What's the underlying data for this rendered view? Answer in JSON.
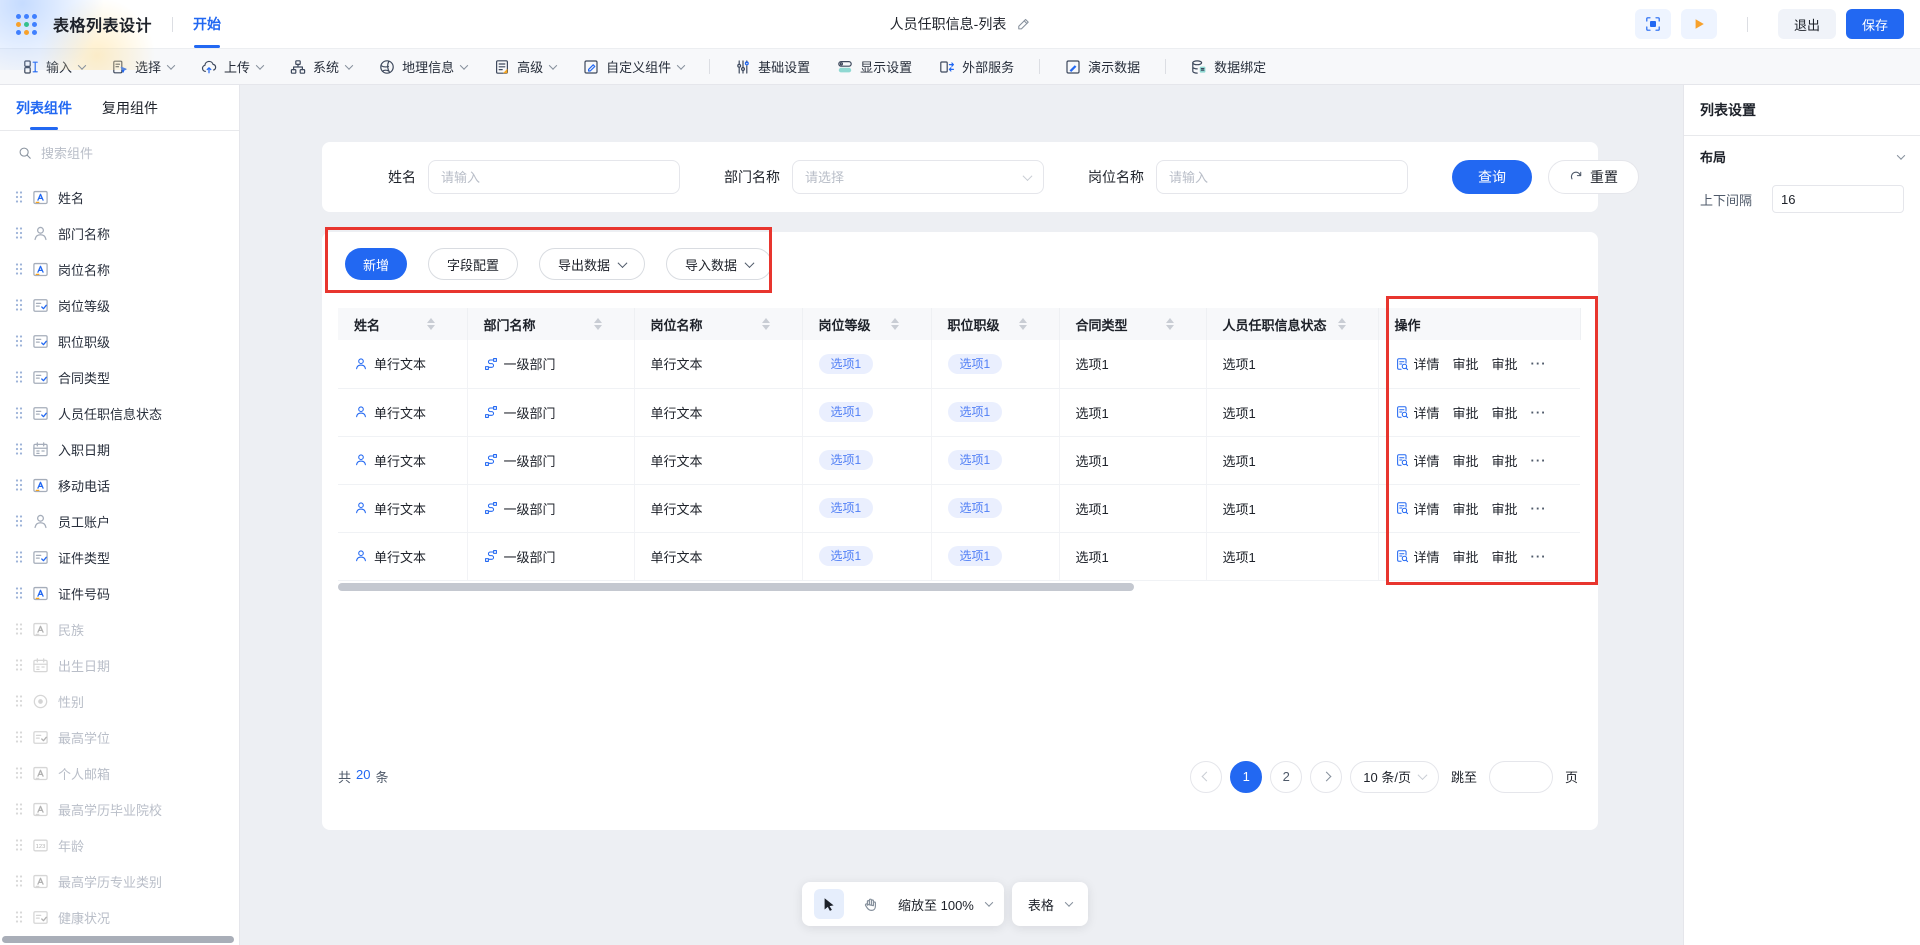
{
  "topbar": {
    "app_title": "表格列表设计",
    "start_tab": "开始",
    "page_title": "人员任职信息-列表",
    "exit": "退出",
    "save": "保存"
  },
  "ribbon": {
    "items": [
      {
        "label": "输入",
        "icon": "input",
        "dropdown": true
      },
      {
        "label": "选择",
        "icon": "selectTool",
        "dropdown": true
      },
      {
        "label": "上传",
        "icon": "upload",
        "dropdown": true
      },
      {
        "label": "系统",
        "icon": "system",
        "dropdown": true
      },
      {
        "label": "地理信息",
        "icon": "geo",
        "dropdown": true
      },
      {
        "label": "高级",
        "icon": "advanced",
        "dropdown": true
      },
      {
        "label": "自定义组件",
        "icon": "custom",
        "dropdown": true
      },
      {
        "label": "基础设置",
        "icon": "sliders",
        "sep": true
      },
      {
        "label": "显示设置",
        "icon": "display"
      },
      {
        "label": "外部服务",
        "icon": "external"
      },
      {
        "label": "演示数据",
        "icon": "demo",
        "sep": true
      },
      {
        "label": "数据绑定",
        "icon": "binding",
        "sep": true
      }
    ]
  },
  "sidebar": {
    "tabs": [
      {
        "label": "列表组件",
        "active": true
      },
      {
        "label": "复用组件"
      }
    ],
    "search_placeholder": "搜索组件",
    "items": [
      {
        "label": "姓名",
        "icon": "textField"
      },
      {
        "label": "部门名称",
        "icon": "person"
      },
      {
        "label": "岗位名称",
        "icon": "textField"
      },
      {
        "label": "岗位等级",
        "icon": "selectField"
      },
      {
        "label": "职位职级",
        "icon": "selectField"
      },
      {
        "label": "合同类型",
        "icon": "selectField"
      },
      {
        "label": "人员任职信息状态",
        "icon": "selectField"
      },
      {
        "label": "入职日期",
        "icon": "calendar"
      },
      {
        "label": "移动电话",
        "icon": "textField"
      },
      {
        "label": "员工账户",
        "icon": "person"
      },
      {
        "label": "证件类型",
        "icon": "selectField"
      },
      {
        "label": "证件号码",
        "icon": "textField"
      },
      {
        "label": "民族",
        "icon": "textField",
        "disabled": true
      },
      {
        "label": "出生日期",
        "icon": "calendar",
        "disabled": true
      },
      {
        "label": "性别",
        "icon": "radio",
        "disabled": true
      },
      {
        "label": "最高学位",
        "icon": "selectField",
        "disabled": true
      },
      {
        "label": "个人邮箱",
        "icon": "textField",
        "disabled": true
      },
      {
        "label": "最高学历毕业院校",
        "icon": "textField",
        "disabled": true
      },
      {
        "label": "年龄",
        "icon": "number",
        "disabled": true
      },
      {
        "label": "最高学历专业类别",
        "icon": "textField",
        "disabled": true
      },
      {
        "label": "健康状况",
        "icon": "selectField",
        "disabled": true
      }
    ]
  },
  "filters": {
    "fields": [
      {
        "label": "姓名",
        "placeholder": "请输入"
      },
      {
        "label": "部门名称",
        "placeholder": "请选择",
        "dropdown": true
      },
      {
        "label": "岗位名称",
        "placeholder": "请输入"
      }
    ],
    "search": "查询",
    "reset": "重置"
  },
  "actions": {
    "add": "新增",
    "field_config": "字段配置",
    "export": "导出数据",
    "import": "导入数据"
  },
  "table": {
    "columns": [
      {
        "label": "姓名",
        "sortable": true
      },
      {
        "label": "部门名称",
        "sortable": true
      },
      {
        "label": "岗位名称",
        "sortable": true
      },
      {
        "label": "岗位等级",
        "sortable": true
      },
      {
        "label": "职位职级",
        "sortable": true
      },
      {
        "label": "合同类型",
        "sortable": true
      },
      {
        "label": "人员任职信息状态",
        "sortable": true
      },
      {
        "label": "操作"
      }
    ],
    "rows": [
      {
        "name": "单行文本",
        "dept": "一级部门",
        "post": "单行文本",
        "grade": "选项1",
        "rank": "选项1",
        "contract": "选项1",
        "status": "选项1",
        "detail": "详情",
        "approve1": "审批",
        "approve2": "审批",
        "more": "···"
      },
      {
        "name": "单行文本",
        "dept": "一级部门",
        "post": "单行文本",
        "grade": "选项1",
        "rank": "选项1",
        "contract": "选项1",
        "status": "选项1",
        "detail": "详情",
        "approve1": "审批",
        "approve2": "审批",
        "more": "···"
      },
      {
        "name": "单行文本",
        "dept": "一级部门",
        "post": "单行文本",
        "grade": "选项1",
        "rank": "选项1",
        "contract": "选项1",
        "status": "选项1",
        "detail": "详情",
        "approve1": "审批",
        "approve2": "审批",
        "more": "···"
      },
      {
        "name": "单行文本",
        "dept": "一级部门",
        "post": "单行文本",
        "grade": "选项1",
        "rank": "选项1",
        "contract": "选项1",
        "status": "选项1",
        "detail": "详情",
        "approve1": "审批",
        "approve2": "审批",
        "more": "···"
      },
      {
        "name": "单行文本",
        "dept": "一级部门",
        "post": "单行文本",
        "grade": "选项1",
        "rank": "选项1",
        "contract": "选项1",
        "status": "选项1",
        "detail": "详情",
        "approve1": "审批",
        "approve2": "审批",
        "more": "···"
      }
    ]
  },
  "pagination": {
    "total_prefix": "共",
    "total_count": "20",
    "total_suffix": "条",
    "pages": [
      {
        "num": "1",
        "active": true
      },
      {
        "num": "2"
      }
    ],
    "page_size": "10 条/页",
    "jump_label": "跳至",
    "page_unit": "页"
  },
  "settings": {
    "title": "列表设置",
    "section": "布局",
    "spacing_label": "上下间隔",
    "spacing_value": "16"
  },
  "bottom_bar": {
    "zoom_label": "缩放至 100%",
    "mode_label": "表格"
  }
}
